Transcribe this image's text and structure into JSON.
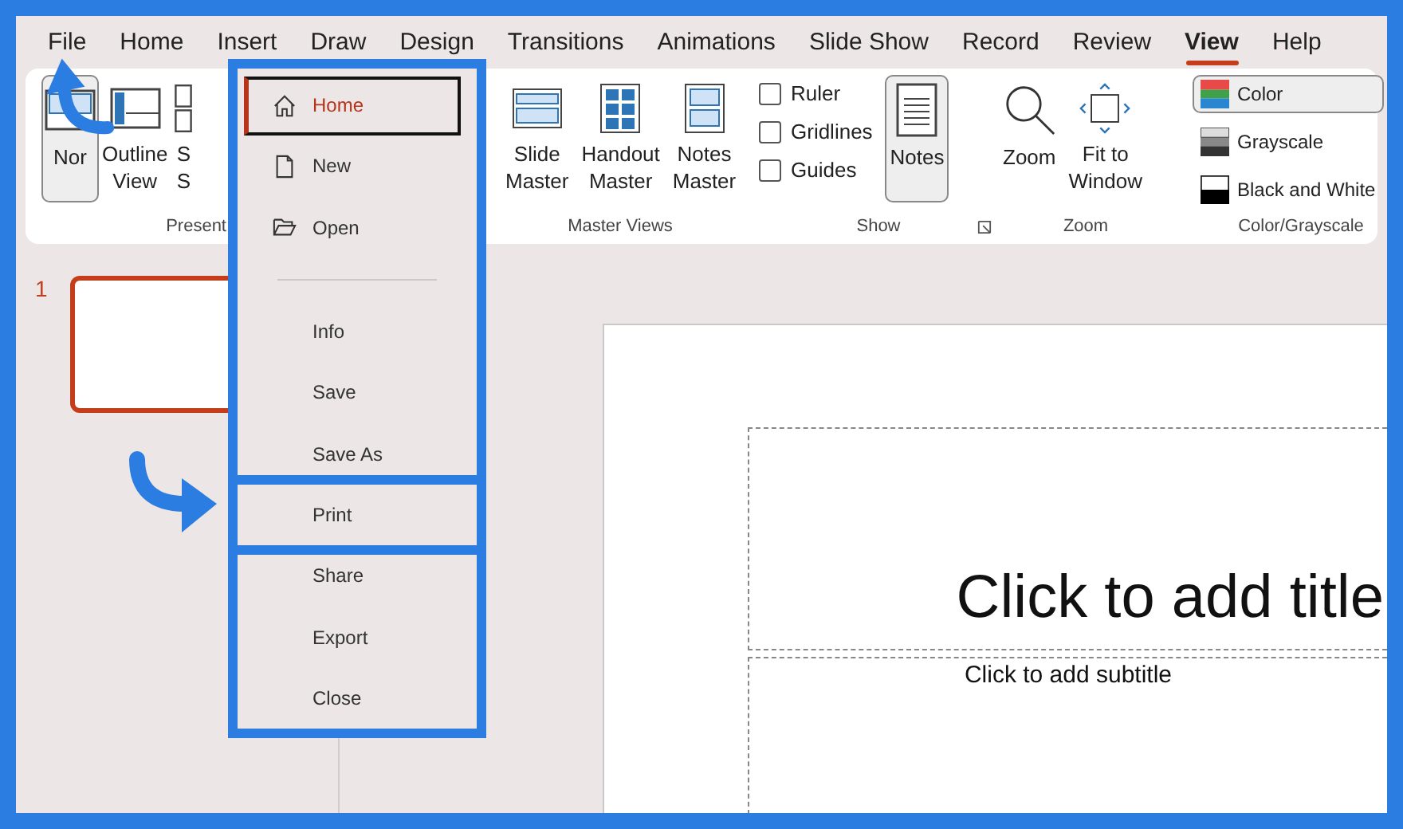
{
  "tabs": [
    {
      "label": "File",
      "selected": false
    },
    {
      "label": "Home",
      "selected": false
    },
    {
      "label": "Insert",
      "selected": false
    },
    {
      "label": "Draw",
      "selected": false
    },
    {
      "label": "Design",
      "selected": false
    },
    {
      "label": "Transitions",
      "selected": false
    },
    {
      "label": "Animations",
      "selected": false
    },
    {
      "label": "Slide Show",
      "selected": false
    },
    {
      "label": "Record",
      "selected": false
    },
    {
      "label": "Review",
      "selected": false
    },
    {
      "label": "View",
      "selected": true
    },
    {
      "label": "Help",
      "selected": false
    }
  ],
  "ribbon": {
    "groups": [
      {
        "label": "Present",
        "items": [
          {
            "kind": "big",
            "lines": [
              "Nor"
            ],
            "selected": true
          },
          {
            "kind": "big",
            "lines": [
              "Outline",
              "View"
            ],
            "selected": false
          },
          {
            "kind": "big",
            "lines": [
              "S",
              "S"
            ],
            "selected": false
          }
        ]
      },
      {
        "label": "Master Views",
        "items": [
          {
            "kind": "big",
            "lines": [
              "Slide",
              "Master"
            ],
            "selected": false
          },
          {
            "kind": "big",
            "lines": [
              "Handout",
              "Master"
            ],
            "selected": false
          },
          {
            "kind": "big",
            "lines": [
              "Notes",
              "Master"
            ],
            "selected": false
          }
        ]
      },
      {
        "label": "Show",
        "launcher": true,
        "items": [
          {
            "kind": "check",
            "label": "Ruler",
            "checked": false
          },
          {
            "kind": "check",
            "label": "Gridlines",
            "checked": false
          },
          {
            "kind": "check",
            "label": "Guides",
            "checked": false
          },
          {
            "kind": "big",
            "lines": [
              "Notes"
            ],
            "selected": true
          }
        ]
      },
      {
        "label": "Zoom",
        "items": [
          {
            "kind": "big",
            "lines": [
              "Zoom"
            ],
            "selected": false
          },
          {
            "kind": "big",
            "lines": [
              "Fit to",
              "Window"
            ],
            "selected": false
          }
        ]
      },
      {
        "label": "Color/Grayscale",
        "items": [
          {
            "kind": "swatch",
            "label": "Color",
            "selected": true
          },
          {
            "kind": "swatch",
            "label": "Grayscale",
            "selected": false
          },
          {
            "kind": "swatch",
            "label": "Black and White",
            "selected": false
          }
        ]
      }
    ]
  },
  "slides": [
    {
      "number": "1",
      "selected": true
    }
  ],
  "slide": {
    "title_placeholder": "Click to add title",
    "subtitle_placeholder": "Click to add subtitle"
  },
  "file_menu": {
    "items": [
      {
        "kind": "item",
        "label": "Home",
        "selected": true,
        "highlighted": false
      },
      {
        "kind": "item",
        "label": "New",
        "selected": false,
        "highlighted": false
      },
      {
        "kind": "item",
        "label": "Open",
        "selected": false,
        "highlighted": false
      },
      {
        "kind": "separator"
      },
      {
        "kind": "item",
        "label": "Info",
        "selected": false,
        "highlighted": false
      },
      {
        "kind": "item",
        "label": "Save",
        "selected": false,
        "highlighted": false
      },
      {
        "kind": "item",
        "label": "Save As",
        "selected": false,
        "highlighted": false
      },
      {
        "kind": "item",
        "label": "Print",
        "selected": false,
        "highlighted": true
      },
      {
        "kind": "item",
        "label": "Share",
        "selected": false,
        "highlighted": false
      },
      {
        "kind": "item",
        "label": "Export",
        "selected": false,
        "highlighted": false
      },
      {
        "kind": "item",
        "label": "Close",
        "selected": false,
        "highlighted": false
      }
    ]
  }
}
